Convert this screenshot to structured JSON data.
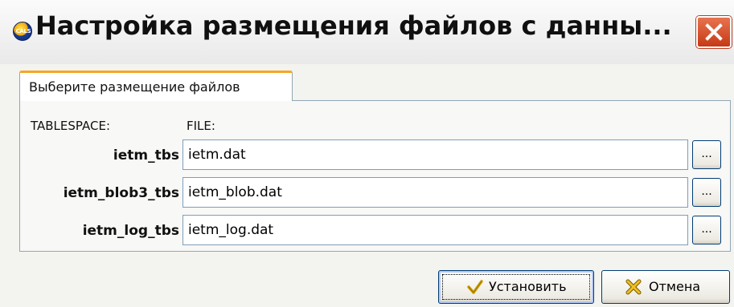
{
  "window": {
    "title": "Настройка размещения файлов с данны...",
    "app_icon_text": "CALS"
  },
  "tab": {
    "label": "Выберите размещение файлов"
  },
  "columns": {
    "tablespace_header": "TABLESPACE:",
    "file_header": "FILE:"
  },
  "rows": [
    {
      "tablespace": "ietm_tbs",
      "file": "ietm.dat",
      "browse_label": "..."
    },
    {
      "tablespace": "ietm_blob3_tbs",
      "file": "ietm_blob.dat",
      "browse_label": "..."
    },
    {
      "tablespace": "ietm_log_tbs",
      "file": "ietm_log.dat",
      "browse_label": "..."
    }
  ],
  "buttons": {
    "ok_label": "Установить",
    "cancel_label": "Отмена"
  },
  "icons": {
    "app": "cals-logo-icon",
    "close": "close-icon",
    "ok": "checkmark-icon",
    "cancel": "cross-icon"
  },
  "colors": {
    "close_button": "#c63a16",
    "tab_accent": "#f5a623",
    "border": "#7f9db9"
  }
}
